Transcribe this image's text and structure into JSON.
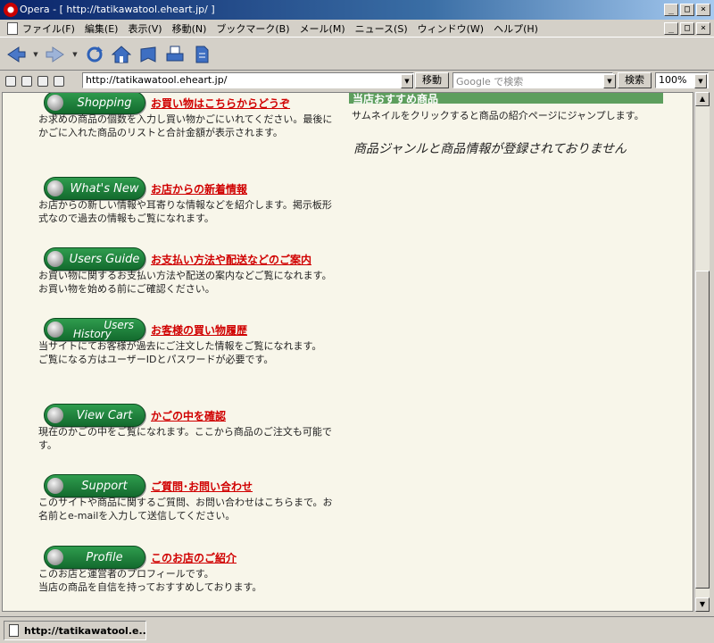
{
  "window": {
    "title": "Opera - [ http://tatikawatool.eheart.jp/ ]",
    "minimize": "_",
    "maximize": "□",
    "close": "×"
  },
  "menu": [
    "ファイル(F)",
    "編集(E)",
    "表示(V)",
    "移動(N)",
    "ブックマーク(B)",
    "メール(M)",
    "ニュース(S)",
    "ウィンドウ(W)",
    "ヘルプ(H)"
  ],
  "address": {
    "url": "http://tatikawatool.eheart.jp/",
    "go_label": "移動",
    "search_placeholder": "Google で検索",
    "search_label": "検索",
    "zoom": "100%"
  },
  "sections": [
    {
      "button": "Shopping",
      "link": "お買い物はこちらからどうぞ",
      "desc": "お求めの商品の個数を入力し買い物かごにいれてください。最後にかごに入れた商品のリストと合計金額が表示されます。"
    },
    {
      "button": "What's New",
      "link": "お店からの新着情報",
      "desc": "お店からの新しい情報や耳寄りな情報などを紹介します。掲示板形式なので過去の情報もご覧になれます。"
    },
    {
      "button": "Users Guide",
      "link": "お支払い方法や配送などのご案内",
      "desc": "お買い物に関するお支払い方法や配送の案内などご覧になれます。お買い物を始める前にご確認ください。"
    },
    {
      "button_line1": "Users",
      "button_line2": "History",
      "link": "お客様の買い物履歴",
      "desc": "当サイトにてお客様が過去にご注文した情報をご覧になれます。",
      "desc2": "ご覧になる方はユーザーIDとパスワードが必要です。"
    },
    {
      "button": "View Cart",
      "link": "かごの中を確認",
      "desc": "現在のかごの中をご覧になれます。ここから商品のご注文も可能です。"
    },
    {
      "button": "Support",
      "link": "ご質問･お問い合わせ",
      "desc": "このサイトや商品に関するご質問、お問い合わせはこちらまで。お名前とe-mailを入力して送信してください。"
    },
    {
      "button": "Profile",
      "link": "このお店のご紹介",
      "desc": "このお店と運営者のプロフィールです。",
      "desc2": "当店の商品を自信を持っておすすめしております。"
    }
  ],
  "recommend": {
    "heading": "当店おすすめ商品",
    "desc": "サムネイルをクリックすると商品の紹介ページにジャンプします。",
    "empty": "商品ジャンルと商品情報が登録されておりません"
  },
  "status": {
    "text": "http://tatikawatool.e..."
  },
  "colors": {
    "button_green": "#1f8a3e",
    "link_red": "#d00000",
    "page_bg": "#f8f6ea",
    "recommend_header": "#5d9e5d"
  }
}
